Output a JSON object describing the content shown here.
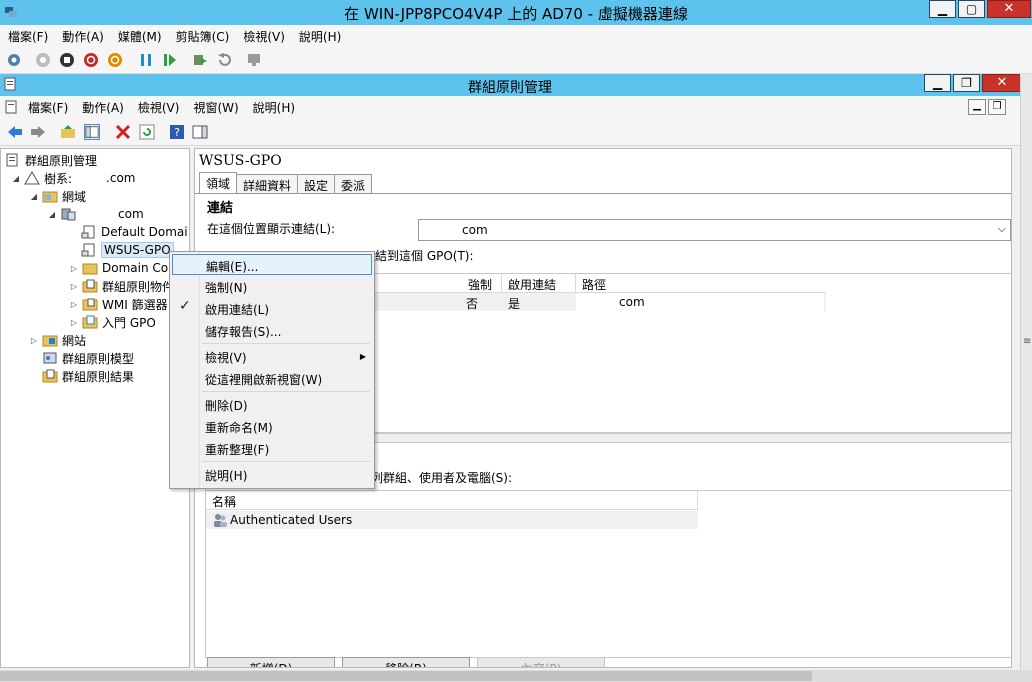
{
  "vm": {
    "title": "在 WIN-JPP8PCO4V4P 上的 AD70 - 虛擬機器連線",
    "menu": [
      "檔案(F)",
      "動作(A)",
      "媒體(M)",
      "剪貼簿(C)",
      "檢視(V)",
      "說明(H)"
    ]
  },
  "mmc": {
    "title": "群組原則管理",
    "menu": [
      "檔案(F)",
      "動作(A)",
      "檢視(V)",
      "視窗(W)",
      "說明(H)"
    ]
  },
  "tree": {
    "items": [
      {
        "label": "群組原則管理"
      },
      {
        "label": "樹系:",
        "suffix": ".com"
      },
      {
        "label": "網域"
      },
      {
        "label": "com"
      },
      {
        "label": "Default Domai"
      },
      {
        "label": "WSUS-GPO"
      },
      {
        "label": "Domain Co"
      },
      {
        "label": "群組原則物件"
      },
      {
        "label": "WMI 篩選器"
      },
      {
        "label": "入門 GPO"
      },
      {
        "label": "網站"
      },
      {
        "label": "群組原則模型"
      },
      {
        "label": "群組原則結果"
      }
    ]
  },
  "right": {
    "gpo_name": "WSUS-GPO",
    "tabs": [
      "領域",
      "詳細資料",
      "設定",
      "委派"
    ],
    "links_heading": "連結",
    "location_label": "在這個位置顯示連結(L):",
    "location_value": "com",
    "linked_label": "結到這個 GPO(T):",
    "columns": [
      "強制",
      "啟用連結",
      "路徑"
    ],
    "row": {
      "enforced": "否",
      "enabled": "是",
      "path": "com"
    },
    "filter_label": "列群組、使用者及電腦(S):",
    "filter_column": "名稱",
    "filter_row": "Authenticated Users",
    "buttons": [
      "新增(D)",
      "移除(R)",
      "內容(P)"
    ]
  },
  "context_menu": {
    "items": [
      "編輯(E)...",
      "強制(N)",
      "啟用連結(L)",
      "儲存報告(S)...",
      "檢視(V)",
      "從這裡開啟新視窗(W)",
      "刪除(D)",
      "重新命名(M)",
      "重新整理(F)",
      "說明(H)"
    ]
  }
}
